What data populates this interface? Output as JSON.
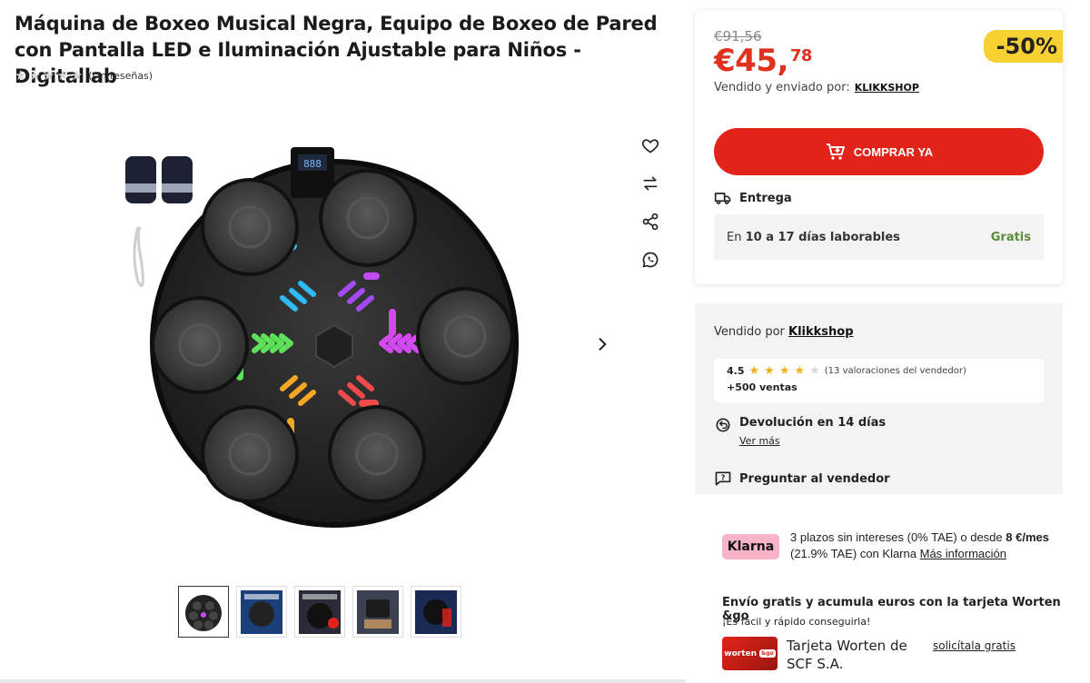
{
  "product": {
    "title": "Máquina de Boxeo Musical Negra, Equipo de Boxeo de Pared con Pantalla LED e Iluminación Ajustable para Niños - Digitallab",
    "reviews_text": "(sin reseñas)",
    "rating_stars": 0,
    "display_value": "888"
  },
  "gallery": {
    "thumbnail_count": 5,
    "active_thumbnail": 0
  },
  "price": {
    "old": "€91,56",
    "main": "€45,",
    "cents": "78",
    "discount": "-50%",
    "sold_by_label": "Vendido y enviado por:",
    "sold_by_name": "KLIKKSHOP"
  },
  "buy_button": {
    "label": "COMPRAR YA"
  },
  "delivery": {
    "heading": "Entrega",
    "prefix": "En",
    "range": "10 a 17 días laborables",
    "cost": "Gratis"
  },
  "seller": {
    "label": "Vendido por",
    "name": "Klikkshop",
    "score": "4.5",
    "stars_filled": 4.5,
    "ratings_count": "(13 valoraciones del vendedor)",
    "sales": "+500 ventas",
    "return_title": "Devolución en 14 días",
    "return_link": "Ver más",
    "ask": "Preguntar al vendedor"
  },
  "klarna": {
    "badge": "Klarna",
    "text_a": "3 plazos sin intereses (0% TAE) o desde",
    "amount": "8 €/mes",
    "text_b": "(21.9% TAE) con Klarna",
    "link": "Más información"
  },
  "worten": {
    "title": "Envío gratis y acumula euros con la tarjeta Worten &go",
    "subtitle": "¡Es fácil y rápido conseguirla!",
    "card_brand": "worten",
    "card_tag": "&go",
    "card_name": "Tarjeta Worten de SCF S.A.",
    "link": "solicítala gratis"
  },
  "colors": {
    "accent_red": "#e2231a",
    "price_red": "#e0301e",
    "discount_yellow": "#f7d031",
    "free_green": "#5c8a3b",
    "klarna_pink": "#f7b4c8"
  },
  "icons": [
    "heart-icon",
    "compare-icon",
    "share-icon",
    "whatsapp-icon",
    "chevron-right-icon",
    "cart-icon",
    "truck-icon",
    "return-icon",
    "chat-icon"
  ]
}
